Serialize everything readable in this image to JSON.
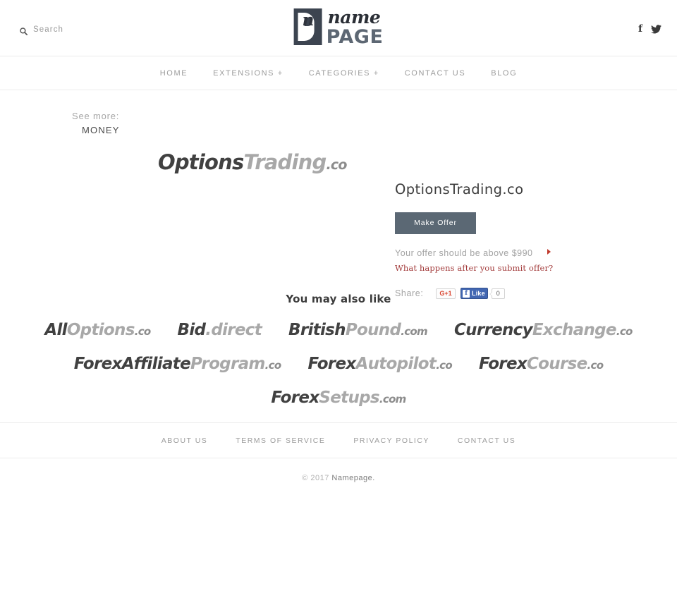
{
  "header": {
    "search": {
      "label": "Search",
      "icon": "search-icon"
    },
    "logo": {
      "mark_letter": "n",
      "word_script": "name",
      "word_bold": "PAGE"
    },
    "social": [
      {
        "name": "facebook-icon",
        "glyph": "f"
      },
      {
        "name": "twitter-icon",
        "glyph": "bird"
      }
    ]
  },
  "nav": {
    "items": [
      {
        "label": "HOME"
      },
      {
        "label": "EXTENSIONS +"
      },
      {
        "label": "CATEGORIES +"
      },
      {
        "label": "CONTACT US"
      },
      {
        "label": "BLOG"
      }
    ]
  },
  "see_more": {
    "label": "See more:",
    "category": "MONEY"
  },
  "domain": {
    "logo_parts": {
      "dark": "Options",
      "light": "Trading",
      "tld": ".co"
    },
    "title": "OptionsTrading.co",
    "make_offer_label": "Make Offer",
    "offer_hint": "Your offer should be above $990",
    "offer_minimum": "$990",
    "offer_question_link": "What happens after you submit offer?",
    "share": {
      "label": "Share:",
      "gplus_label": "G+1",
      "facebook_like_label": "Like",
      "facebook_count": "0"
    }
  },
  "also_like": {
    "title": "You may also like",
    "rows": [
      [
        {
          "dark": "All",
          "light": "Options",
          "tld": ".co"
        },
        {
          "dark": "Bid",
          "light": ".direct",
          "tld": ""
        },
        {
          "dark": "British",
          "light": "Pound",
          "tld": ".com"
        },
        {
          "dark": "Currency",
          "light": "Exchange",
          "tld": ".co"
        }
      ],
      [
        {
          "dark": "ForexAffiliate",
          "light": "Program",
          "tld": ".co"
        },
        {
          "dark": "Forex",
          "light": "Autopilot",
          "tld": ".co"
        },
        {
          "dark": "Forex",
          "light": "Course",
          "tld": ".co"
        }
      ],
      [
        {
          "dark": "Forex",
          "light": "Setups",
          "tld": ".com"
        }
      ]
    ]
  },
  "footer": {
    "links": [
      {
        "label": "ABOUT US"
      },
      {
        "label": "TERMS OF SERVICE"
      },
      {
        "label": "PRIVACY POLICY"
      },
      {
        "label": "CONTACT US"
      }
    ],
    "copyright_prefix": "© 2017 ",
    "copyright_name": "Namepage."
  },
  "colors": {
    "button": "#5b6874",
    "link_red": "#a33c3c",
    "logo_dark": "#3c4450",
    "facebook_blue": "#4267b2",
    "gplus_red": "#d9442f"
  }
}
